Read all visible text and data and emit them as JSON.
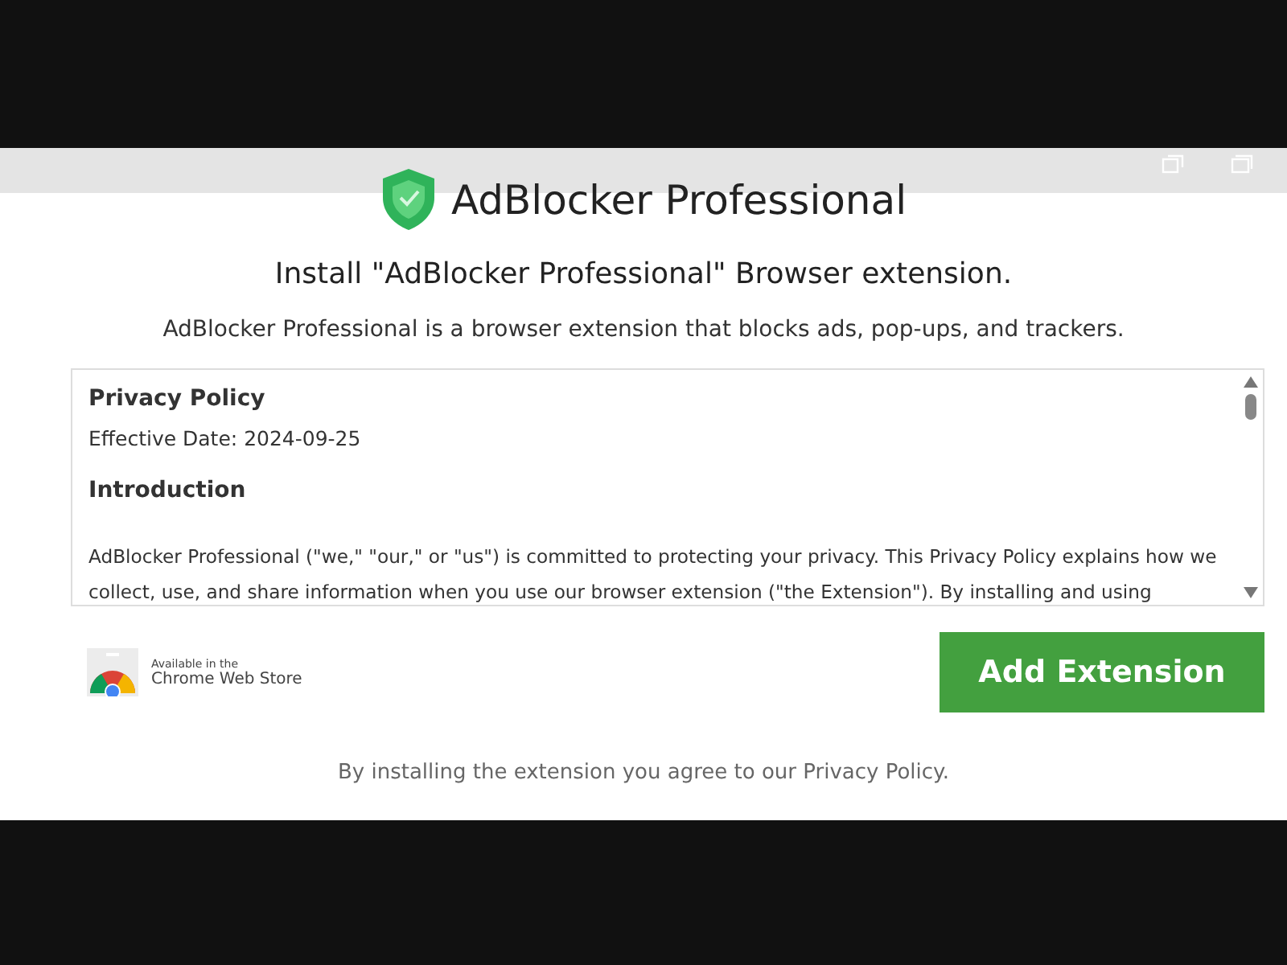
{
  "brand": {
    "name": "AdBlocker Professional"
  },
  "heading": "Install \"AdBlocker Professional\" Browser extension.",
  "subtitle": "AdBlocker Professional is a browser extension that blocks ads, pop-ups, and trackers.",
  "policy": {
    "title": "Privacy Policy",
    "date": "Effective Date: 2024-09-25",
    "section": "Introduction",
    "paragraph": "AdBlocker Professional (\"we,\" \"our,\" or \"us\") is committed to protecting your privacy. This Privacy Policy explains how we collect, use, and share information when you use our browser extension (\"the Extension\"). By installing and using"
  },
  "store_badge": {
    "line_1": "Available in the",
    "line_2": "Chrome Web Store"
  },
  "button": "Add Extension",
  "footer": "By installing the extension you agree to our Privacy Policy."
}
